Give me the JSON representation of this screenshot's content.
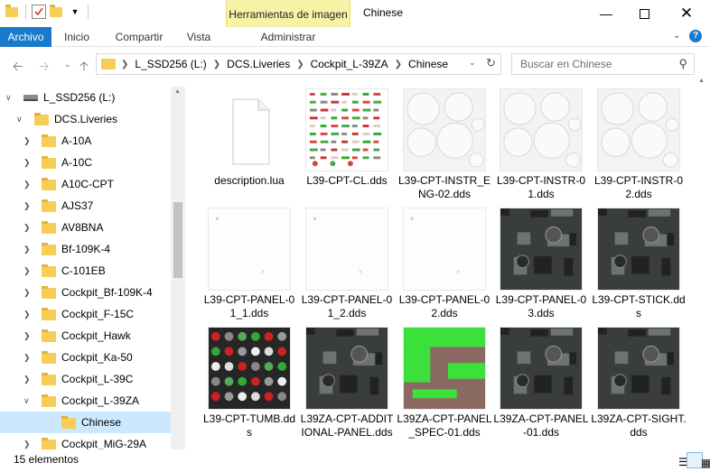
{
  "window": {
    "title": "Chinese",
    "context_tab": "Herramientas de imagen",
    "context_subtab": "Administrar"
  },
  "ribbon": {
    "tabs": [
      {
        "label": "Archivo",
        "active": true
      },
      {
        "label": "Inicio",
        "active": false
      },
      {
        "label": "Compartir",
        "active": false
      },
      {
        "label": "Vista",
        "active": false
      }
    ]
  },
  "address": {
    "crumbs": [
      "L_SSD256 (L:)",
      "DCS.Liveries",
      "Cockpit_L-39ZA",
      "Chinese"
    ]
  },
  "search": {
    "placeholder": "Buscar en Chinese"
  },
  "tree": [
    {
      "label": "L_SSD256 (L:)",
      "level": 0,
      "expanded": true,
      "type": "drive"
    },
    {
      "label": "DCS.Liveries",
      "level": 1,
      "expanded": true,
      "type": "folder"
    },
    {
      "label": "A-10A",
      "level": 2,
      "expanded": false,
      "type": "folder"
    },
    {
      "label": "A-10C",
      "level": 2,
      "expanded": false,
      "type": "folder"
    },
    {
      "label": "A10C-CPT",
      "level": 2,
      "expanded": false,
      "type": "folder"
    },
    {
      "label": "AJS37",
      "level": 2,
      "expanded": false,
      "type": "folder"
    },
    {
      "label": "AV8BNA",
      "level": 2,
      "expanded": false,
      "type": "folder"
    },
    {
      "label": "Bf-109K-4",
      "level": 2,
      "expanded": false,
      "type": "folder"
    },
    {
      "label": "C-101EB",
      "level": 2,
      "expanded": false,
      "type": "folder"
    },
    {
      "label": "Cockpit_Bf-109K-4",
      "level": 2,
      "expanded": false,
      "type": "folder"
    },
    {
      "label": "Cockpit_F-15C",
      "level": 2,
      "expanded": false,
      "type": "folder"
    },
    {
      "label": "Cockpit_Hawk",
      "level": 2,
      "expanded": false,
      "type": "folder"
    },
    {
      "label": "Cockpit_Ka-50",
      "level": 2,
      "expanded": false,
      "type": "folder"
    },
    {
      "label": "Cockpit_L-39C",
      "level": 2,
      "expanded": false,
      "type": "folder"
    },
    {
      "label": "Cockpit_L-39ZA",
      "level": 2,
      "expanded": true,
      "type": "folder"
    },
    {
      "label": "Chinese",
      "level": 3,
      "expanded": false,
      "type": "folder",
      "selected": true
    },
    {
      "label": "Cockpit_MiG-29A",
      "level": 2,
      "expanded": false,
      "type": "folder"
    }
  ],
  "files": [
    {
      "name": "description.lua",
      "kind": "doc"
    },
    {
      "name": "L39-CPT-CL.dds",
      "kind": "labels"
    },
    {
      "name": "L39-CPT-INSTR_ENG-02.dds",
      "kind": "dials"
    },
    {
      "name": "L39-CPT-INSTR-01.dds",
      "kind": "dials"
    },
    {
      "name": "L39-CPT-INSTR-02.dds",
      "kind": "dials"
    },
    {
      "name": "L39-CPT-PANEL-01_1.dds",
      "kind": "blank"
    },
    {
      "name": "L39-CPT-PANEL-01_2.dds",
      "kind": "blank"
    },
    {
      "name": "L39-CPT-PANEL-02.dds",
      "kind": "blank"
    },
    {
      "name": "L39-CPT-PANEL-03.dds",
      "kind": "darkpanel"
    },
    {
      "name": "L39-CPT-STICK.dds",
      "kind": "darkpanel"
    },
    {
      "name": "L39-CPT-TUMB.dds",
      "kind": "buttons"
    },
    {
      "name": "L39ZA-CPT-ADDITIONAL-PANEL.dds",
      "kind": "darkpanel"
    },
    {
      "name": "L39ZA-CPT-PANEL_SPEC-01.dds",
      "kind": "green"
    },
    {
      "name": "L39ZA-CPT-PANEL-01.dds",
      "kind": "darkpanel"
    },
    {
      "name": "L39ZA-CPT-SIGHT.dds",
      "kind": "darkpanel"
    }
  ],
  "status": {
    "count_text": "15 elementos"
  },
  "colors": {
    "accent": "#1979ca",
    "context_tab_bg": "#f8f2a6",
    "selection": "#cce8ff"
  }
}
